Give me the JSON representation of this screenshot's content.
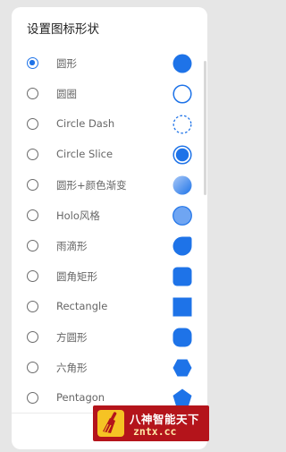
{
  "dialog": {
    "title": "设置图标形状",
    "options": [
      {
        "label": "圆形",
        "checked": true,
        "icon": "filled-circle-icon"
      },
      {
        "label": "圆圈",
        "checked": false,
        "icon": "ring-icon"
      },
      {
        "label": "Circle Dash",
        "checked": false,
        "icon": "dashed-circle-icon"
      },
      {
        "label": "Circle Slice",
        "checked": false,
        "icon": "circle-slice-icon"
      },
      {
        "label": "圆形+颜色渐变",
        "checked": false,
        "icon": "gradient-circle-icon"
      },
      {
        "label": "Holo风格",
        "checked": false,
        "icon": "holo-circle-icon"
      },
      {
        "label": "雨滴形",
        "checked": false,
        "icon": "raindrop-icon"
      },
      {
        "label": "圆角矩形",
        "checked": false,
        "icon": "rounded-rect-icon"
      },
      {
        "label": "Rectangle",
        "checked": false,
        "icon": "square-icon"
      },
      {
        "label": "方圆形",
        "checked": false,
        "icon": "squircle-icon"
      },
      {
        "label": "六角形",
        "checked": false,
        "icon": "hexagon-icon"
      },
      {
        "label": "Pentagon",
        "checked": false,
        "icon": "pentagon-icon"
      }
    ]
  },
  "watermark": {
    "title": "八神智能天下",
    "url": "zntx.cc"
  },
  "colors": {
    "accent": "#1e73e8",
    "watermark_bg": "#b4141b"
  }
}
